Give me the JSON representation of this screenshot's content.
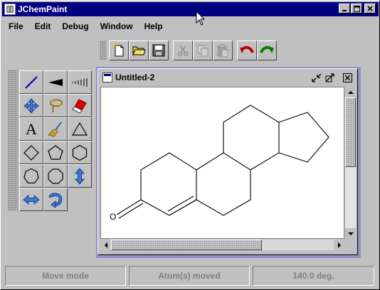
{
  "window": {
    "title": "JChemPaint"
  },
  "title_buttons": {
    "minimize": "_",
    "maximize": "□",
    "close": "×"
  },
  "menu": [
    {
      "label": "File"
    },
    {
      "label": "Edit"
    },
    {
      "label": "Debug"
    },
    {
      "label": "Window"
    },
    {
      "label": "Help"
    }
  ],
  "toolbar": {
    "buttons": [
      {
        "icon": "new-document-icon",
        "enabled": true
      },
      {
        "icon": "open-folder-icon",
        "enabled": true
      },
      {
        "icon": "save-disk-icon",
        "enabled": true
      },
      {
        "icon": "cut-scissors-icon",
        "enabled": false
      },
      {
        "icon": "copy-icon",
        "enabled": false
      },
      {
        "icon": "paste-icon",
        "enabled": false
      },
      {
        "icon": "undo-icon",
        "enabled": true,
        "color": "#c00000"
      },
      {
        "icon": "redo-icon",
        "enabled": true,
        "color": "#008000"
      }
    ]
  },
  "palette": {
    "tools": [
      "draw-bond-icon",
      "wedge-bond-icon",
      "hash-bond-icon",
      "move-icon",
      "lasso-select-icon",
      "eraser-icon",
      "atom-label-icon",
      "cleanup-broom-icon",
      "triangle-ring-icon",
      "square-ring-icon",
      "pentagon-ring-icon",
      "hexagon-ring-icon",
      "heptagon-ring-icon",
      "octagon-ring-icon",
      "flip-vertical-icon",
      "flip-horizontal-icon",
      "rotate-icon"
    ],
    "atom_label_text": "A"
  },
  "document": {
    "title": "Untitled-2",
    "molecule_atom_label": "O"
  },
  "status": {
    "mode": "Move mode",
    "message": "Atom(s) moved",
    "angle": "140.0 deg."
  },
  "colors": {
    "titlebar": "#000080",
    "desktop": "#9090c8",
    "bond": "#000000"
  }
}
